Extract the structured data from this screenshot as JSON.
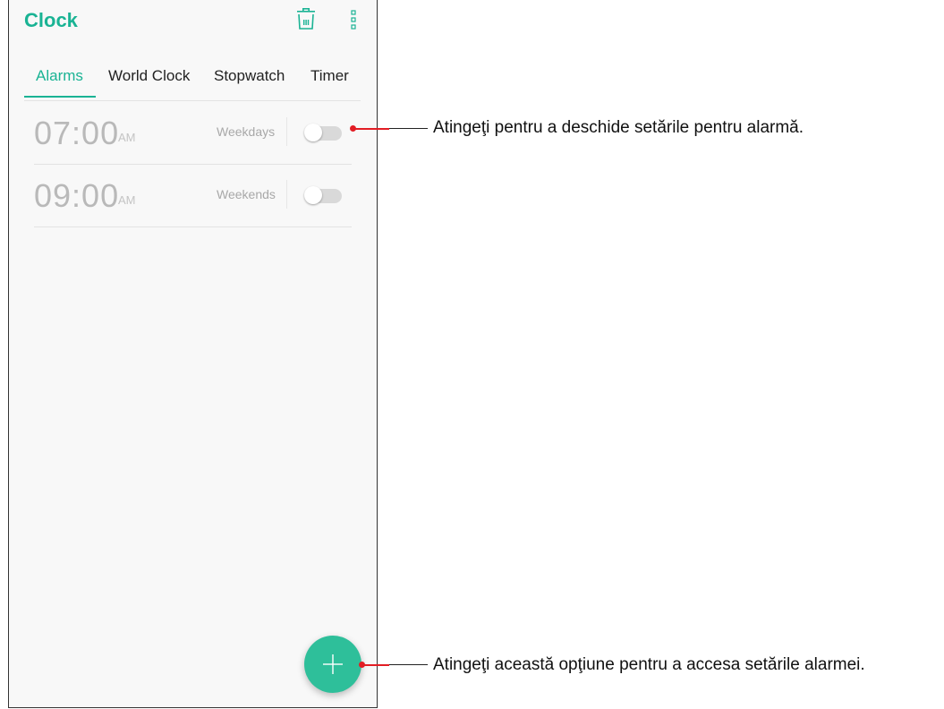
{
  "app": {
    "title": "Clock"
  },
  "toolbar": {
    "delete_icon": "trash-icon",
    "more_icon": "more-vert-icon"
  },
  "tabs": [
    {
      "label": "Alarms",
      "active": true
    },
    {
      "label": "World Clock",
      "active": false
    },
    {
      "label": "Stopwatch",
      "active": false
    },
    {
      "label": "Timer",
      "active": false
    }
  ],
  "alarms": [
    {
      "time": "07:00",
      "ampm": "AM",
      "repeat": "Weekdays",
      "enabled": false
    },
    {
      "time": "09:00",
      "ampm": "AM",
      "repeat": "Weekends",
      "enabled": false
    }
  ],
  "fab": {
    "icon": "plus-icon"
  },
  "callouts": [
    {
      "text": "Atingeţi pentru a deschide setările pentru alarmă."
    },
    {
      "text": "Atingeţi această opţiune pentru a accesa setările alarmei."
    }
  ],
  "colors": {
    "accent": "#1ab394",
    "fab": "#2ebf9a",
    "callout_marker": "#e21d24"
  }
}
